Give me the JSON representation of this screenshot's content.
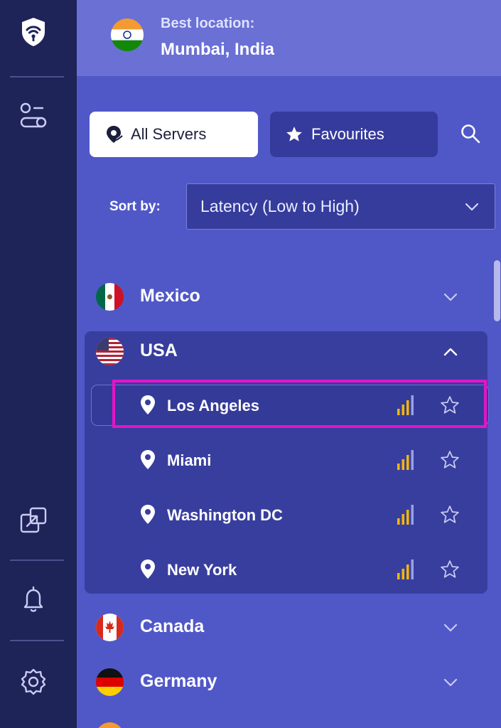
{
  "best_location": {
    "label": "Best location:",
    "value": "Mumbai, India"
  },
  "tabs": {
    "all_servers": "All Servers",
    "favourites": "Favourites",
    "active": "All Servers"
  },
  "sort": {
    "label": "Sort by:",
    "value": "Latency (Low to High)"
  },
  "countries": [
    {
      "name": "Mexico",
      "expanded": false
    },
    {
      "name": "USA",
      "expanded": true
    },
    {
      "name": "Canada",
      "expanded": false
    },
    {
      "name": "Germany",
      "expanded": false
    }
  ],
  "usa_cities": [
    {
      "name": "Los Angeles",
      "selected": true
    },
    {
      "name": "Miami",
      "selected": false
    },
    {
      "name": "Washington DC",
      "selected": false
    },
    {
      "name": "New York",
      "selected": false
    }
  ],
  "signal_strength": {
    "active_bars": 3,
    "total_bars": 4
  },
  "colors": {
    "rail": "#1e2358",
    "main": "#5058c8",
    "signal": "#f2b705",
    "highlight": "#e613c8"
  },
  "icons": {
    "rail": [
      "app-logo-icon",
      "toggles-icon",
      "split-tunnel-icon",
      "bell-icon",
      "settings-gear-icon"
    ]
  }
}
